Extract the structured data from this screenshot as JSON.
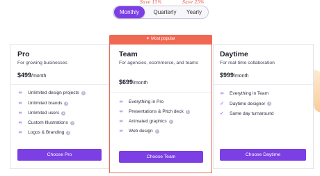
{
  "billing_toggle": {
    "options": [
      "Monthly",
      "Quarterly",
      "Yearly"
    ],
    "selected": "Monthly",
    "save_quarterly": "Save 15%",
    "save_yearly": "Save 25%"
  },
  "badge": {
    "label": "Most popular"
  },
  "plans": [
    {
      "name": "Pro",
      "description": "For growing businesses",
      "price": "$499",
      "period": "/month",
      "features": [
        {
          "label": "Unlimited design projects",
          "info": true
        },
        {
          "label": "Unlimited brands",
          "info": true
        },
        {
          "label": "Unlimited users",
          "info": true
        },
        {
          "label": "Custom Illustrations",
          "info": true
        },
        {
          "label": "Logos & Branding",
          "info": true
        }
      ],
      "cta": "Choose Pro"
    },
    {
      "name": "Team",
      "description": "For agencies, ecommerce, and teams",
      "price": "$699",
      "period": "/month",
      "features": [
        {
          "label": "Everything in Pro",
          "info": false
        },
        {
          "label": "Presentations & Pitch deck",
          "info": true
        },
        {
          "label": "Animated graphics",
          "info": true
        },
        {
          "label": "Web design",
          "info": true
        }
      ],
      "cta": "Choose Team"
    },
    {
      "name": "Daytime",
      "description": "For real-time collaboration",
      "price": "$999",
      "period": "/month",
      "features": [
        {
          "label": "Everything in Team",
          "info": false
        },
        {
          "label": "Daytime designer",
          "info": true
        },
        {
          "label": "Same day turnaround",
          "info": false
        }
      ],
      "cta": "Choose Daytime"
    }
  ],
  "colors": {
    "accent": "#7b3fe4",
    "highlight": "#f06852",
    "save_text": "#e04a3b"
  },
  "icons": {
    "infinity": "infinity-icon",
    "check": "check-icon",
    "info": "info-icon",
    "sparkle": "sparkle-icon"
  }
}
